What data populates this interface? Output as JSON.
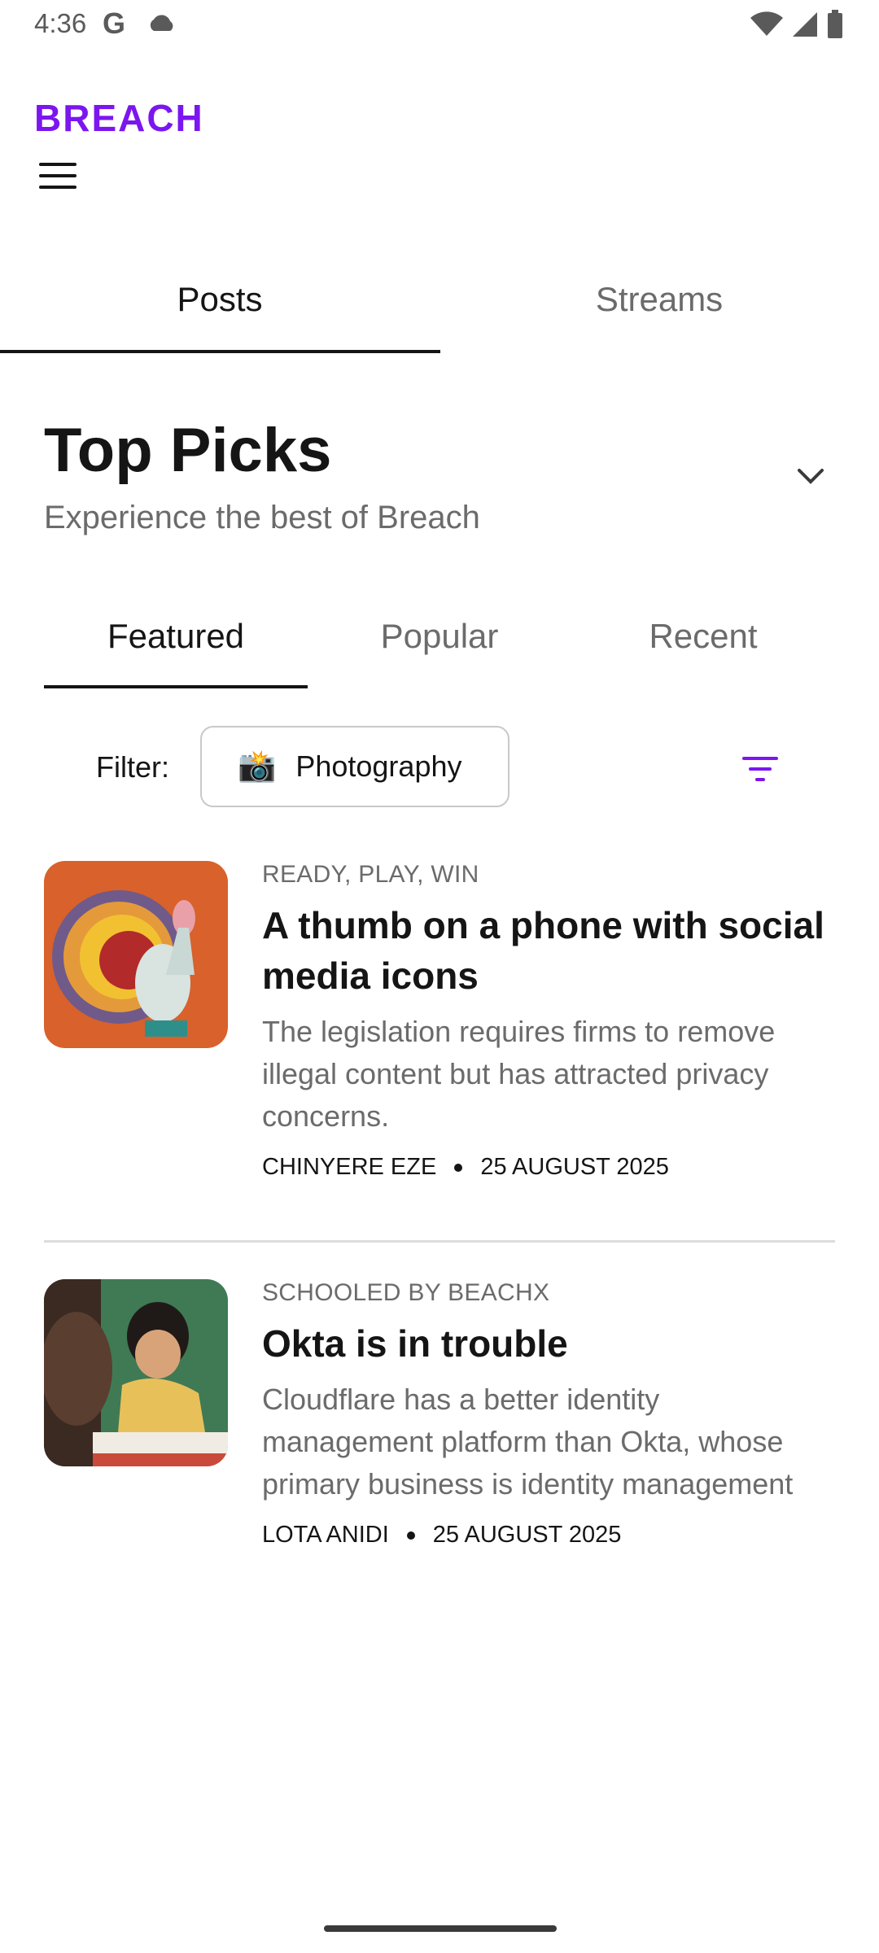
{
  "status_bar": {
    "time": "4:36",
    "google_glyph": "G",
    "icons": [
      "cloud-icon",
      "wifi-icon",
      "signal-icon",
      "battery-icon"
    ]
  },
  "app": {
    "brand": "BREACH",
    "brand_color": "#7b16f0",
    "menu_icon": "hamburger-menu-icon"
  },
  "main_tabs": [
    {
      "label": "Posts",
      "active": true
    },
    {
      "label": "Streams",
      "active": false
    }
  ],
  "section": {
    "title": "Top Picks",
    "subtitle": "Experience the best of Breach",
    "expand_icon": "chevron-down-icon"
  },
  "sub_tabs": [
    {
      "label": "Featured",
      "active": true
    },
    {
      "label": "Popular",
      "active": false
    },
    {
      "label": "Recent",
      "active": false
    }
  ],
  "filter": {
    "label": "Filter:",
    "selected": "Photography",
    "chip_icon": "📸",
    "sort_icon": "filter-icon"
  },
  "articles": [
    {
      "category": "READY, PLAY, WIN",
      "title": "A thumb on a phone with social media icons",
      "excerpt": "The legislation requires firms to remove illegal content but has attracted privacy concerns.",
      "author": "CHINYERE EZE",
      "date": "25 AUGUST 2025",
      "thumbnail": "paper-turkey-photo"
    },
    {
      "category": "SCHOOLED BY BEACHX",
      "title": "Okta is in trouble",
      "excerpt": "Cloudflare has a better identity management platform than Okta, whose primary business is identity management",
      "author": "LOTA ANIDI",
      "date": "25 AUGUST 2025",
      "thumbnail": "students-writing-photo"
    }
  ]
}
